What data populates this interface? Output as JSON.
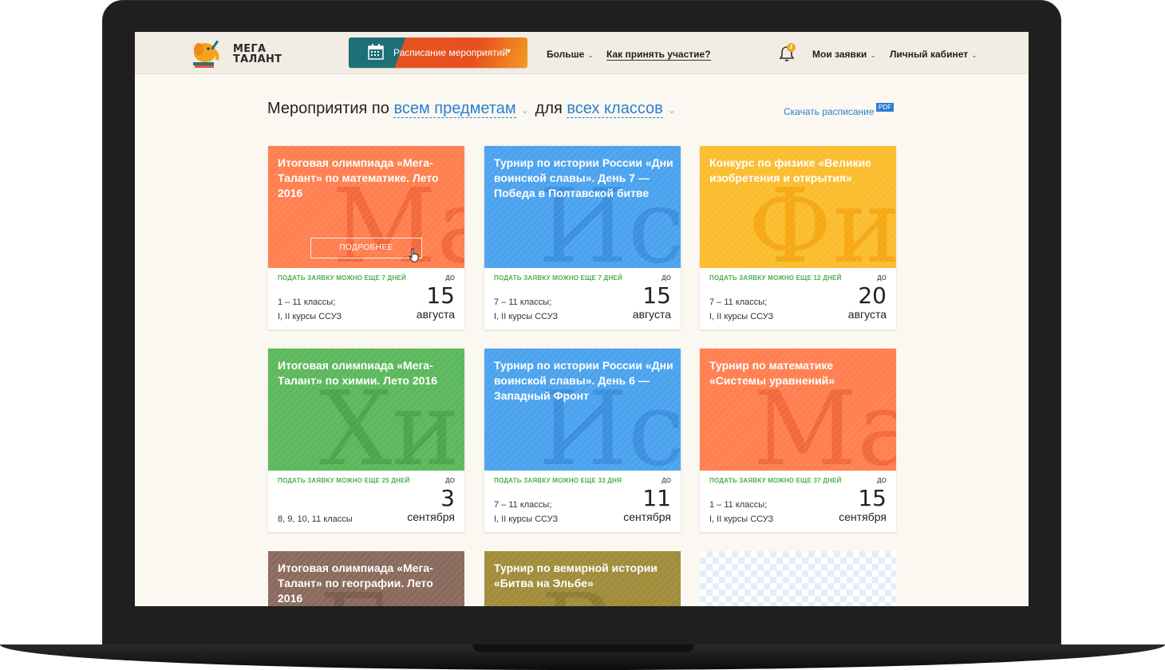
{
  "header": {
    "logo_line1": "МЕГА",
    "logo_line2": "ТАЛАНТ",
    "schedule_label": "Расписание мероприятий",
    "nav_more": "Больше",
    "nav_how": "Как принять участие?",
    "notifications_count": "2",
    "nav_requests": "Мои заявки",
    "nav_cabinet": "Личный кабинет"
  },
  "filter": {
    "prefix": "Мероприятия по",
    "subjects": "всем предметам",
    "mid": "для",
    "grades": "всех классов",
    "download": "Скачать расписание",
    "pdf": "PDF"
  },
  "colors": {
    "orange": "#ff7f50",
    "blue": "#4ba3ee",
    "yellow": "#fbbd2e",
    "green": "#5cb85c",
    "brown": "#8a6a5c",
    "olive": "#a08c3a"
  },
  "cards": [
    {
      "title": "Итоговая олимпиада «Мега-Талант» по математике. Лето 2016",
      "letters": "Ма",
      "note": "ПОДАТЬ ЗАЯВКУ МОЖНО ЕЩЕ 7 ДНЕЙ",
      "until": "ДО",
      "grades1": "1 – 11 классы;",
      "grades2": "I, II курсы ССУЗ",
      "day": "15",
      "month": "августа",
      "more": "ПОДРОБНЕЕ"
    },
    {
      "title": "Турнир по истории России «Дни воинской славы». День 7 — Победа в Полтавской битве",
      "letters": "Ис",
      "note": "ПОДАТЬ ЗАЯВКУ МОЖНО ЕЩЕ 7 ДНЕЙ",
      "until": "ДО",
      "grades1": "7 – 11 классы;",
      "grades2": "I, II курсы ССУЗ",
      "day": "15",
      "month": "августа"
    },
    {
      "title": "Конкурс по физике «Великие изобретения и открытия»",
      "letters": "Фи",
      "note": "ПОДАТЬ ЗАЯВКУ МОЖНО ЕЩЕ 12 ДНЕЙ",
      "until": "ДО",
      "grades1": "7 – 11 классы;",
      "grades2": "I, II курсы ССУЗ",
      "day": "20",
      "month": "августа"
    },
    {
      "title": "Итоговая олимпиада «Мега-Талант» по химии. Лето 2016",
      "letters": "Хи",
      "note": "ПОДАТЬ ЗАЯВКУ МОЖНО ЕЩЕ 25 ДНЕЙ",
      "until": "ДО",
      "grades1": "8, 9, 10, 11 классы",
      "grades2": "",
      "day": "3",
      "month": "сентября"
    },
    {
      "title": "Турнир по истории России «Дни воинской славы». День 6 — Западный Фронт",
      "letters": "Ис",
      "note": "ПОДАТЬ ЗАЯВКУ МОЖНО ЕЩЕ 33 ДНЯ",
      "until": "ДО",
      "grades1": "7 – 11 классы;",
      "grades2": "I, II курсы ССУЗ",
      "day": "11",
      "month": "сентября"
    },
    {
      "title": "Турнир по математике «Системы уравнений»",
      "letters": "Ма",
      "note": "ПОДАТЬ ЗАЯВКУ МОЖНО ЕЩЕ 37 ДНЕЙ",
      "until": "ДО",
      "grades1": "1 – 11 классы;",
      "grades2": "I, II курсы ССУЗ",
      "day": "15",
      "month": "сентября"
    },
    {
      "title": "Итоговая олимпиада «Мега-Талант» по географии. Лето 2016",
      "letters": "Ге"
    },
    {
      "title": "Турнир по вемирной истории «Битва на Эльбе»",
      "letters": "В"
    }
  ]
}
